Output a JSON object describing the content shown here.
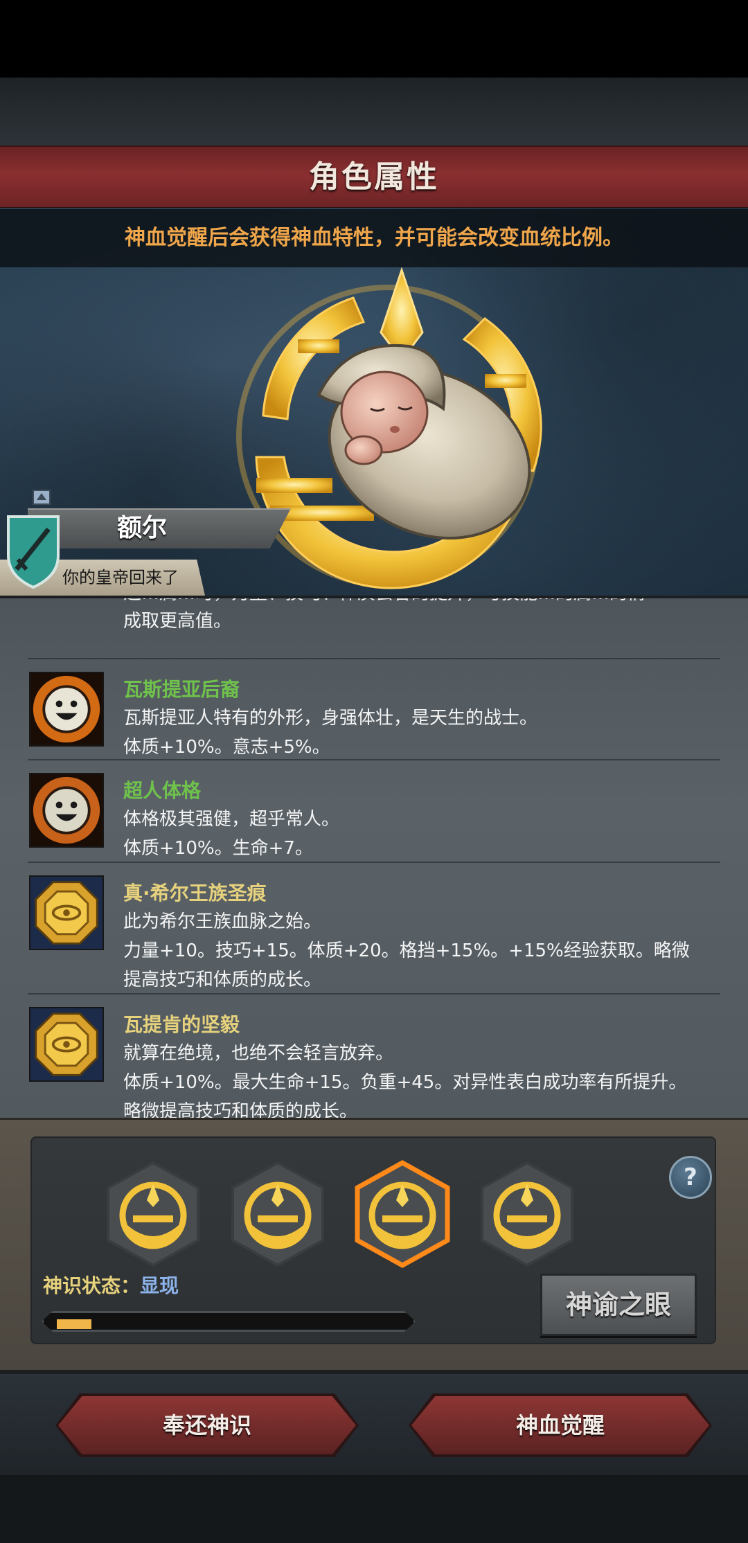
{
  "header": {
    "title": "角色属性",
    "notice": "神血觉醒后会获得神血特性，并可能会改变血统比例。"
  },
  "character": {
    "name": "额尔",
    "subtitle": "你的皇帝回来了",
    "portrait_icon": "swaddled-baby",
    "class_icon": "shield-sword-icon"
  },
  "traits": {
    "partial_line_1": "这…属…时，力量、技巧、体质会各的提升，与技能…的属…的情",
    "partial_line_2": "成取更高值。",
    "items": [
      {
        "icon": "smiling-face-icon",
        "name": "瓦斯提亚后裔",
        "name_color": "#6fc24b",
        "lines": [
          "瓦斯提亚人特有的外形，身强体壮，是天生的战士。",
          "体质+10%。意志+5%。"
        ]
      },
      {
        "icon": "smiling-face-icon",
        "name": "超人体格",
        "name_color": "#6fc24b",
        "lines": [
          "体格极其强健，超乎常人。",
          "体质+10%。生命+7。"
        ]
      },
      {
        "icon": "gold-seal-icon",
        "name": "真·希尔王族圣痕",
        "name_color": "#e6d17c",
        "lines": [
          "此为希尔王族血脉之始。",
          "力量+10。技巧+15。体质+20。格挡+15%。+15%经验获取。略微",
          "提高技巧和体质的成长。"
        ]
      },
      {
        "icon": "gold-seal-icon",
        "name": "瓦提肯的坚毅",
        "name_color": "#e6d17c",
        "lines": [
          "就算在绝境，也绝不会轻言放弃。",
          "体质+10%。最大生命+15。负重+45。对异性表白成功率有所提升。",
          "略微提高技巧和体质的成长。"
        ]
      }
    ]
  },
  "awakening": {
    "slots": [
      {
        "icon": "divine-emblem-icon",
        "selected": false
      },
      {
        "icon": "divine-emblem-icon",
        "selected": false
      },
      {
        "icon": "divine-emblem-icon",
        "selected": true
      },
      {
        "icon": "divine-emblem-icon",
        "selected": false
      }
    ],
    "help_label": "?",
    "status_label": "神识状态：",
    "status_value": "显现",
    "progress": 0.1,
    "oracle_button": "神谕之眼"
  },
  "actions": {
    "return_button": "奉还神识",
    "awaken_button": "神血觉醒"
  },
  "colors": {
    "title_red": "#8a2f30",
    "notice_orange": "#f0a64a",
    "trait_green": "#6fc24b",
    "trait_gold": "#e6d17c",
    "status_blue": "#8cb2ea"
  }
}
